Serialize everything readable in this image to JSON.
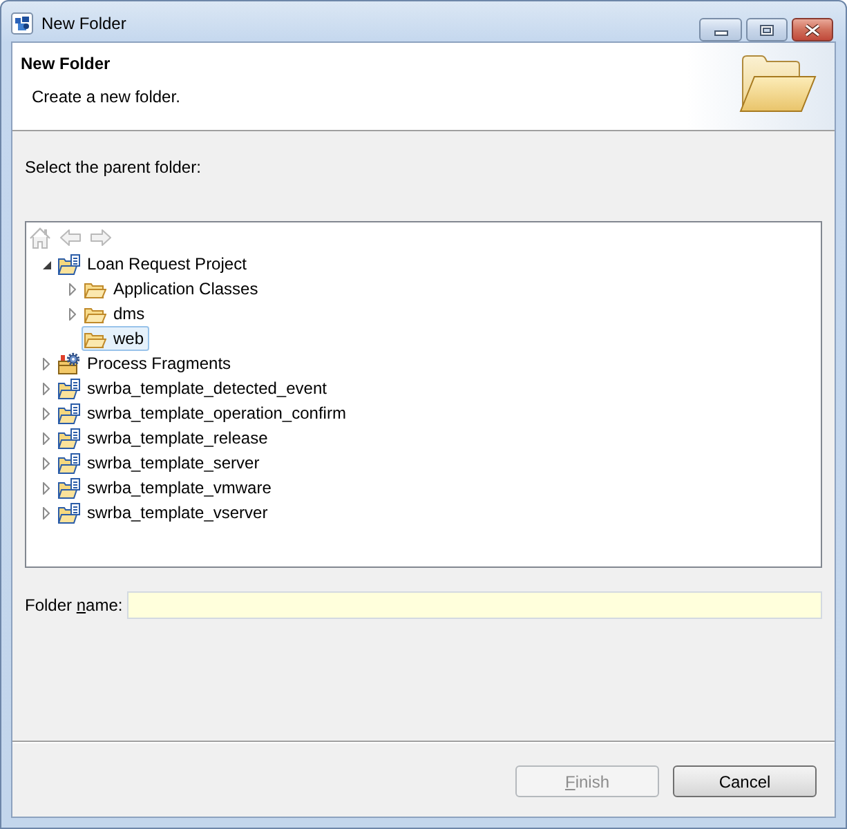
{
  "window": {
    "title": "New Folder",
    "controls": [
      {
        "kind": "minimize"
      },
      {
        "kind": "maximize"
      },
      {
        "kind": "close"
      }
    ]
  },
  "header": {
    "title": "New Folder",
    "description": "Create a new folder."
  },
  "prompt": "Select the parent folder:",
  "tree_toolbar": [
    {
      "kind": "home",
      "disabled": true
    },
    {
      "kind": "back",
      "disabled": true
    },
    {
      "kind": "forward",
      "disabled": true
    }
  ],
  "tree": [
    {
      "label": "Loan Request Project",
      "kind": "project",
      "expanded": true,
      "selected": false,
      "children": [
        {
          "label": "Application Classes",
          "kind": "folder",
          "expanded": false,
          "selected": false
        },
        {
          "label": "dms",
          "kind": "folder",
          "expanded": false,
          "selected": false
        },
        {
          "label": "web",
          "kind": "folder",
          "selected": true
        }
      ]
    },
    {
      "label": "Process Fragments",
      "kind": "fragments",
      "expanded": false,
      "selected": false
    },
    {
      "label": "swrba_template_detected_event",
      "kind": "project",
      "expanded": false,
      "selected": false
    },
    {
      "label": "swrba_template_operation_confirm",
      "kind": "project",
      "expanded": false,
      "selected": false
    },
    {
      "label": "swrba_template_release",
      "kind": "project",
      "expanded": false,
      "selected": false
    },
    {
      "label": "swrba_template_server",
      "kind": "project",
      "expanded": false,
      "selected": false
    },
    {
      "label": "swrba_template_vmware",
      "kind": "project",
      "expanded": false,
      "selected": false
    },
    {
      "label": "swrba_template_vserver",
      "kind": "project",
      "expanded": false,
      "selected": false
    }
  ],
  "folder_name": {
    "label_parts": [
      {
        "text": "Folder ",
        "underlined": false
      },
      {
        "text": "n",
        "underlined": true
      },
      {
        "text": "ame:",
        "underlined": false
      }
    ]
  },
  "buttons": [
    {
      "label_parts": [
        {
          "text": "F",
          "underlined": true
        },
        {
          "text": "inish",
          "underlined": false
        }
      ],
      "disabled": true
    },
    {
      "label_parts": [
        {
          "text": "Cancel",
          "underlined": false
        }
      ],
      "disabled": false
    }
  ]
}
